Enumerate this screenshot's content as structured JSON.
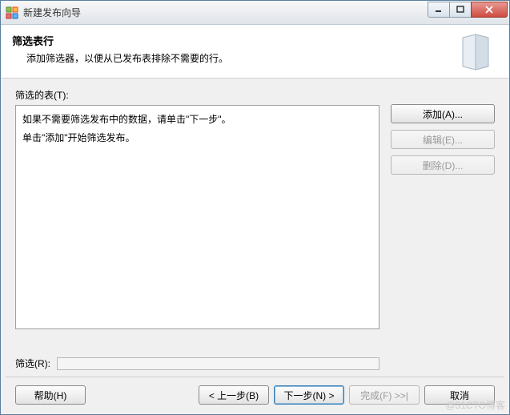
{
  "window": {
    "title": "新建发布向导"
  },
  "header": {
    "title": "筛选表行",
    "subtitle": "添加筛选器，以便从已发布表排除不需要的行。"
  },
  "content": {
    "filter_table_label": "筛选的表(T):",
    "listbox_line1": "如果不需要筛选发布中的数据，请单击\"下一步\"。",
    "listbox_line2": "单击\"添加\"开始筛选发布。",
    "filter_label": "筛选(R):",
    "filter_value": ""
  },
  "side_buttons": {
    "add": "添加(A)...",
    "edit": "编辑(E)...",
    "delete": "删除(D)..."
  },
  "footer": {
    "help": "帮助(H)",
    "back": "< 上一步(B)",
    "next": "下一步(N) >",
    "finish": "完成(F) >>|",
    "cancel": "取消"
  },
  "watermark": "@51CTO博客"
}
